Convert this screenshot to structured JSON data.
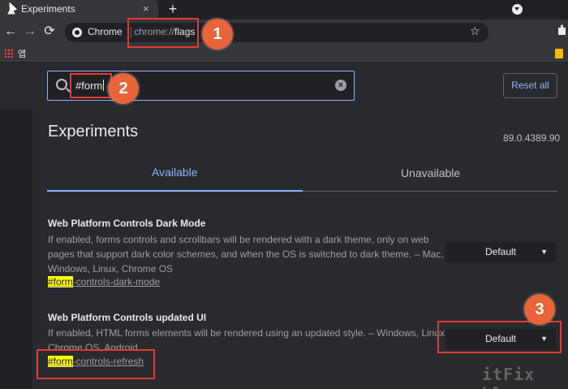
{
  "browser": {
    "tab_title": "Experiments",
    "tab_close": "×",
    "new_tab": "+",
    "nav": {
      "back": "←",
      "forward": "→",
      "reload": "⟳"
    },
    "omnibox": {
      "chip": "Chrome",
      "url_scheme": "chrome://",
      "url_path": "flags",
      "star": "☆"
    },
    "bookmarks": {
      "apps_label": "앱"
    },
    "extension_icon": "puzzle-icon"
  },
  "flags": {
    "search": {
      "value": "#form",
      "clear": "×"
    },
    "reset_label": "Reset all",
    "title": "Experiments",
    "version": "89.0.4389.90",
    "tabs": [
      "Available",
      "Unavailable"
    ],
    "experiments": [
      {
        "title": "Web Platform Controls Dark Mode",
        "desc_lines": [
          "If enabled, forms controls and scrollbars will be rendered with a dark theme, only on web",
          "pages that support dark color schemes, and when the OS is switched to dark theme. – Mac,",
          "Windows, Linux, Chrome OS"
        ],
        "link_highlight": "#form",
        "link_rest": "-controls-dark-mode",
        "select_value": "Default"
      },
      {
        "title": "Web Platform Controls updated UI",
        "desc_lines": [
          "If enabled, HTML forms elements will be rendered using an updated style. – Windows, Linux,",
          "Chrome OS, Android"
        ],
        "link_highlight": "#form",
        "link_rest": "-controls-refresh",
        "select_value": "Default"
      }
    ]
  },
  "annotations": {
    "badges": [
      "1",
      "2",
      "3"
    ],
    "color": "#e53935"
  },
  "watermark": "itFix blog",
  "colors": {
    "accent": "#8ab4f8",
    "highlight": "#ffff00",
    "badge": "#e8643a"
  }
}
